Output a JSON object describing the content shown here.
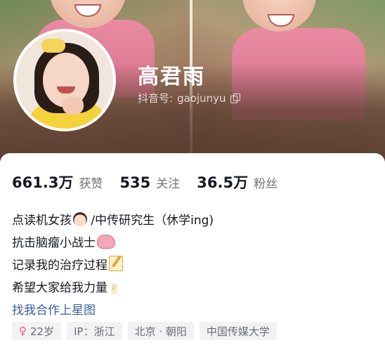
{
  "profile": {
    "name": "高君雨",
    "id_label": "抖音号:",
    "id_value": "gaojunyu"
  },
  "stats": [
    {
      "value": "661.3万",
      "label": "获赞"
    },
    {
      "value": "535",
      "label": "关注"
    },
    {
      "value": "36.5万",
      "label": "粉丝"
    }
  ],
  "bio": {
    "line1": "点读机女孩",
    "line1_suffix": " /中传研究生（休学ing)",
    "line2": "抗击脑瘤小战士",
    "line3": "记录我的治疗过程",
    "line4": "希望大家给我力量",
    "link": "找我合作上星图"
  },
  "tags": {
    "gender_icon": "female-icon",
    "age": "22岁",
    "ip": "IP：浙江",
    "location": "北京 · 朝阳",
    "school": "中国传媒大学"
  },
  "colors": {
    "link": "#3b5f9e",
    "female_icon": "#f1577a",
    "tag_bg": "#f2f2f3"
  }
}
